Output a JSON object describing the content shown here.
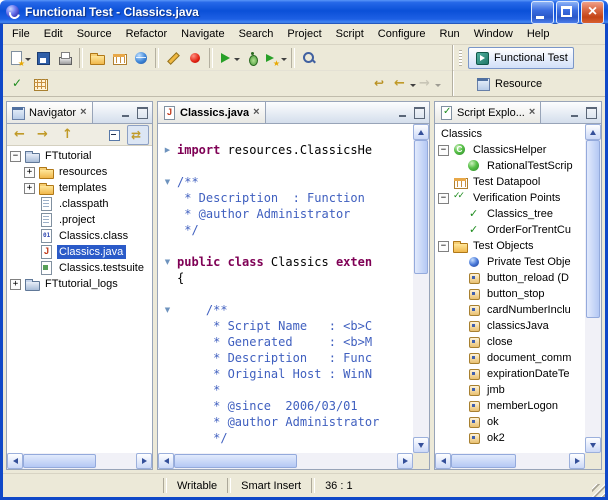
{
  "window": {
    "title": "Functional Test - Classics.java"
  },
  "menu": {
    "items": [
      "File",
      "Edit",
      "Source",
      "Refactor",
      "Navigate",
      "Search",
      "Project",
      "Script",
      "Configure",
      "Run",
      "Window",
      "Help"
    ]
  },
  "toolbar": {
    "row1": [
      {
        "icon": "new-script",
        "dropdown": true
      },
      {
        "icon": "save"
      },
      {
        "icon": "print"
      },
      {
        "separator": true
      },
      {
        "icon": "new-folder"
      },
      {
        "icon": "new-datapool"
      },
      {
        "icon": "web-browser"
      },
      {
        "separator": true
      },
      {
        "icon": "object-inspector"
      },
      {
        "icon": "record"
      },
      {
        "separator": true
      },
      {
        "icon": "run",
        "dropdown": true
      },
      {
        "icon": "debug"
      },
      {
        "icon": "run-config",
        "dropdown": true
      },
      {
        "separator": true
      },
      {
        "icon": "search"
      }
    ],
    "row2_left": [
      {
        "icon": "verification-point"
      },
      {
        "icon": "test-object-map"
      }
    ],
    "row2_right": [
      {
        "icon": "last-edit"
      },
      {
        "icon": "back",
        "dropdown": true
      },
      {
        "icon": "forward",
        "dropdown": true,
        "disabled": true
      }
    ],
    "perspectives": [
      {
        "label": "Functional Test",
        "icon": "perspective-ft",
        "active": true
      },
      {
        "label": "Resource",
        "icon": "perspective-resource",
        "active": false
      }
    ]
  },
  "navigator": {
    "tab_label": "Navigator",
    "toolbar": [
      {
        "icon": "nav-back"
      },
      {
        "icon": "nav-forward"
      },
      {
        "icon": "nav-up"
      },
      {
        "icon": "collapse-all",
        "right": true
      },
      {
        "icon": "link-editor",
        "pressed": true
      }
    ],
    "tree": [
      {
        "label": "FTtutorial",
        "level": 0,
        "expander": "minus",
        "icon": "project"
      },
      {
        "label": "resources",
        "level": 1,
        "expander": "plus",
        "icon": "folder"
      },
      {
        "label": "templates",
        "level": 1,
        "expander": "plus",
        "icon": "folder"
      },
      {
        "label": ".classpath",
        "level": 1,
        "expander": "none",
        "icon": "file"
      },
      {
        "label": ".project",
        "level": 1,
        "expander": "none",
        "icon": "file"
      },
      {
        "label": "Classics.class",
        "level": 1,
        "expander": "none",
        "icon": "class-file"
      },
      {
        "label": "Classics.java",
        "level": 1,
        "expander": "none",
        "icon": "java-file",
        "selected": true
      },
      {
        "label": "Classics.testsuite",
        "level": 1,
        "expander": "none",
        "icon": "testsuite-file"
      },
      {
        "label": "FTtutorial_logs",
        "level": 0,
        "expander": "plus",
        "icon": "project"
      }
    ]
  },
  "editor": {
    "tab_label": "Classics.java",
    "lines": [
      {
        "fold": "",
        "segments": []
      },
      {
        "fold": "collapsed",
        "segments": [
          {
            "style": "keyword",
            "text": "import"
          },
          {
            "style": "plain",
            "text": " resources.ClassicsHe"
          }
        ]
      },
      {
        "fold": "",
        "segments": []
      },
      {
        "fold": "expanded",
        "segments": [
          {
            "style": "comment",
            "text": "/**"
          }
        ]
      },
      {
        "fold": "",
        "segments": [
          {
            "style": "comment",
            "text": " * Description  : Function"
          }
        ]
      },
      {
        "fold": "",
        "segments": [
          {
            "style": "comment",
            "text": " * @author Administrator"
          }
        ]
      },
      {
        "fold": "",
        "segments": [
          {
            "style": "comment",
            "text": " */"
          }
        ]
      },
      {
        "fold": "",
        "segments": []
      },
      {
        "fold": "expanded",
        "segments": [
          {
            "style": "keyword",
            "text": "public class"
          },
          {
            "style": "plain",
            "text": " Classics "
          },
          {
            "style": "keyword",
            "text": "exten"
          }
        ]
      },
      {
        "fold": "",
        "segments": [
          {
            "style": "plain",
            "text": "{"
          }
        ]
      },
      {
        "fold": "",
        "segments": []
      },
      {
        "fold": "expanded",
        "segments": [
          {
            "style": "comment",
            "text": "    /**"
          }
        ]
      },
      {
        "fold": "",
        "segments": [
          {
            "style": "comment",
            "text": "     * Script Name   : <b>C"
          }
        ]
      },
      {
        "fold": "",
        "segments": [
          {
            "style": "comment",
            "text": "     * Generated     : <b>M"
          }
        ]
      },
      {
        "fold": "",
        "segments": [
          {
            "style": "comment",
            "text": "     * Description   : Func"
          }
        ]
      },
      {
        "fold": "",
        "segments": [
          {
            "style": "comment",
            "text": "     * Original Host : WinN"
          }
        ]
      },
      {
        "fold": "",
        "segments": [
          {
            "style": "comment",
            "text": "     *"
          }
        ]
      },
      {
        "fold": "",
        "segments": [
          {
            "style": "comment",
            "text": "     * @since  2006/03/01"
          }
        ]
      },
      {
        "fold": "",
        "segments": [
          {
            "style": "comment",
            "text": "     * @author Administrator"
          }
        ]
      },
      {
        "fold": "",
        "segments": [
          {
            "style": "comment",
            "text": "     */"
          }
        ]
      },
      {
        "fold": "",
        "segments": []
      }
    ]
  },
  "script_explorer": {
    "tab_label": "Script Explo...",
    "root_label": "Classics",
    "tree": [
      {
        "label": "ClassicsHelper",
        "level": 0,
        "expander": "minus",
        "icon": "helper-class"
      },
      {
        "label": "RationalTestScrip",
        "level": 1,
        "expander": "none",
        "icon": "rts"
      },
      {
        "label": "Test Datapool",
        "level": 0,
        "expander": "none",
        "icon": "datapool"
      },
      {
        "label": "Verification Points",
        "level": 0,
        "expander": "minus",
        "icon": "vp-folder"
      },
      {
        "label": "Classics_tree",
        "level": 1,
        "expander": "none",
        "icon": "vp"
      },
      {
        "label": "OrderForTrentCu",
        "level": 1,
        "expander": "none",
        "icon": "vp"
      },
      {
        "label": "Test Objects",
        "level": 0,
        "expander": "minus",
        "icon": "to-folder"
      },
      {
        "label": "Private Test Obje",
        "level": 1,
        "expander": "none",
        "icon": "test-object-private"
      },
      {
        "label": "button_reload (D",
        "level": 1,
        "expander": "none",
        "icon": "test-object"
      },
      {
        "label": "button_stop",
        "level": 1,
        "expander": "none",
        "icon": "test-object"
      },
      {
        "label": "cardNumberInclu",
        "level": 1,
        "expander": "none",
        "icon": "test-object"
      },
      {
        "label": "classicsJava",
        "level": 1,
        "expander": "none",
        "icon": "test-object"
      },
      {
        "label": "close",
        "level": 1,
        "expander": "none",
        "icon": "test-object"
      },
      {
        "label": "document_comm",
        "level": 1,
        "expander": "none",
        "icon": "test-object"
      },
      {
        "label": "expirationDateTe",
        "level": 1,
        "expander": "none",
        "icon": "test-object"
      },
      {
        "label": "jmb",
        "level": 1,
        "expander": "none",
        "icon": "test-object"
      },
      {
        "label": "memberLogon",
        "level": 1,
        "expander": "none",
        "icon": "test-object"
      },
      {
        "label": "ok",
        "level": 1,
        "expander": "none",
        "icon": "test-object"
      },
      {
        "label": "ok2",
        "level": 1,
        "expander": "none",
        "icon": "test-object"
      }
    ]
  },
  "status": {
    "message": "",
    "writable": "Writable",
    "insert_mode": "Smart Insert",
    "caret": "36 : 1"
  }
}
